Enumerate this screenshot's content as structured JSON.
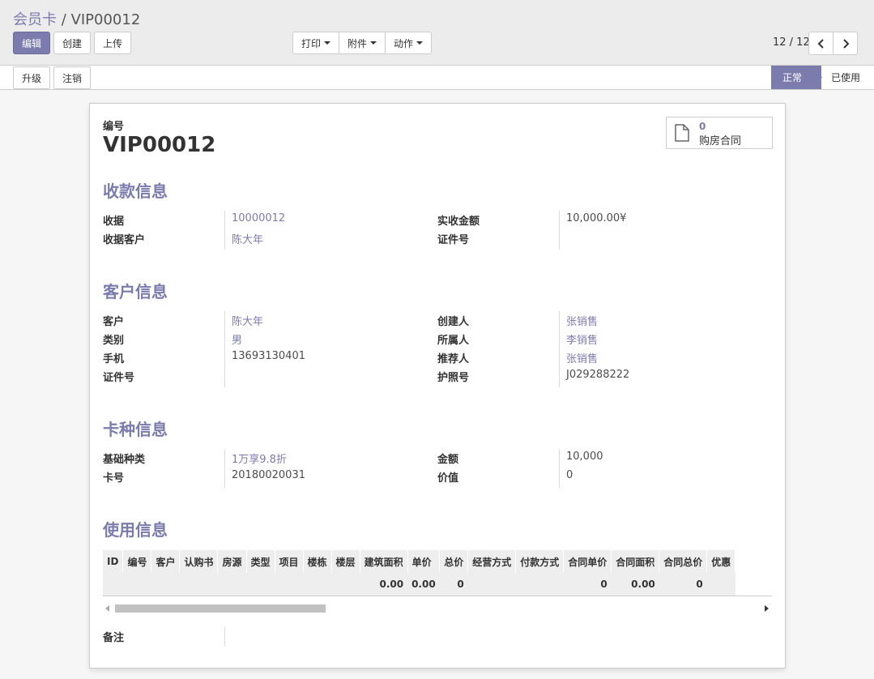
{
  "breadcrumb": {
    "parent": "会员卡",
    "separator": "/",
    "current": "VIP00012"
  },
  "toolbar": {
    "edit": "编辑",
    "create": "创建",
    "import": "上传",
    "print": "打印",
    "attachment": "附件",
    "action": "动作"
  },
  "pager": {
    "value": "12 / 12"
  },
  "status_buttons": {
    "upgrade": "升级",
    "cancel": "注销"
  },
  "stages": {
    "normal": "正常",
    "used": "已使用",
    "active": "正常"
  },
  "record": {
    "number_label": "编号",
    "number": "VIP00012"
  },
  "smart_button": {
    "count": "0",
    "label": "购房合同",
    "icon": "document-icon"
  },
  "payment": {
    "title": "收款信息",
    "receipt_label": "收据",
    "receipt": "10000012",
    "receipt_customer_label": "收据客户",
    "receipt_customer": "陈大年",
    "amount_label": "实收金额",
    "amount": "10,000.00¥",
    "id_label": "证件号",
    "id_value": ""
  },
  "customer": {
    "title": "客户信息",
    "customer_label": "客户",
    "customer": "陈大年",
    "category_label": "类别",
    "category": "男",
    "mobile_label": "手机",
    "mobile": "13693130401",
    "id_label": "证件号",
    "id_value": "",
    "creator_label": "创建人",
    "creator": "张销售",
    "owner_label": "所属人",
    "owner": "李销售",
    "referrer_label": "推荐人",
    "referrer": "张销售",
    "passport_label": "护照号",
    "passport": "J029288222"
  },
  "card": {
    "title": "卡种信息",
    "type_label": "基础种类",
    "type": "1万享9.8折",
    "number_label": "卡号",
    "number": "20180020031",
    "amount_label": "金额",
    "amount": "10,000",
    "value_label": "价值",
    "value": "0"
  },
  "usage": {
    "title": "使用信息",
    "columns": [
      "ID",
      "编号",
      "客户",
      "认购书",
      "房源",
      "类型",
      "项目",
      "楼栋",
      "楼层",
      "建筑面积",
      "单价",
      "总价",
      "经营方式",
      "付款方式",
      "合同单价",
      "合同面积",
      "合同总价",
      "优惠"
    ],
    "totals": [
      "",
      "",
      "",
      "",
      "",
      "",
      "",
      "",
      "",
      "0.00",
      "0.00",
      "0",
      "",
      "",
      "0",
      "0.00",
      "0",
      ""
    ]
  },
  "notes": {
    "label": "备注",
    "value": ""
  },
  "colors": {
    "accent": "#7c7bad",
    "background": "#f6f6f6"
  }
}
